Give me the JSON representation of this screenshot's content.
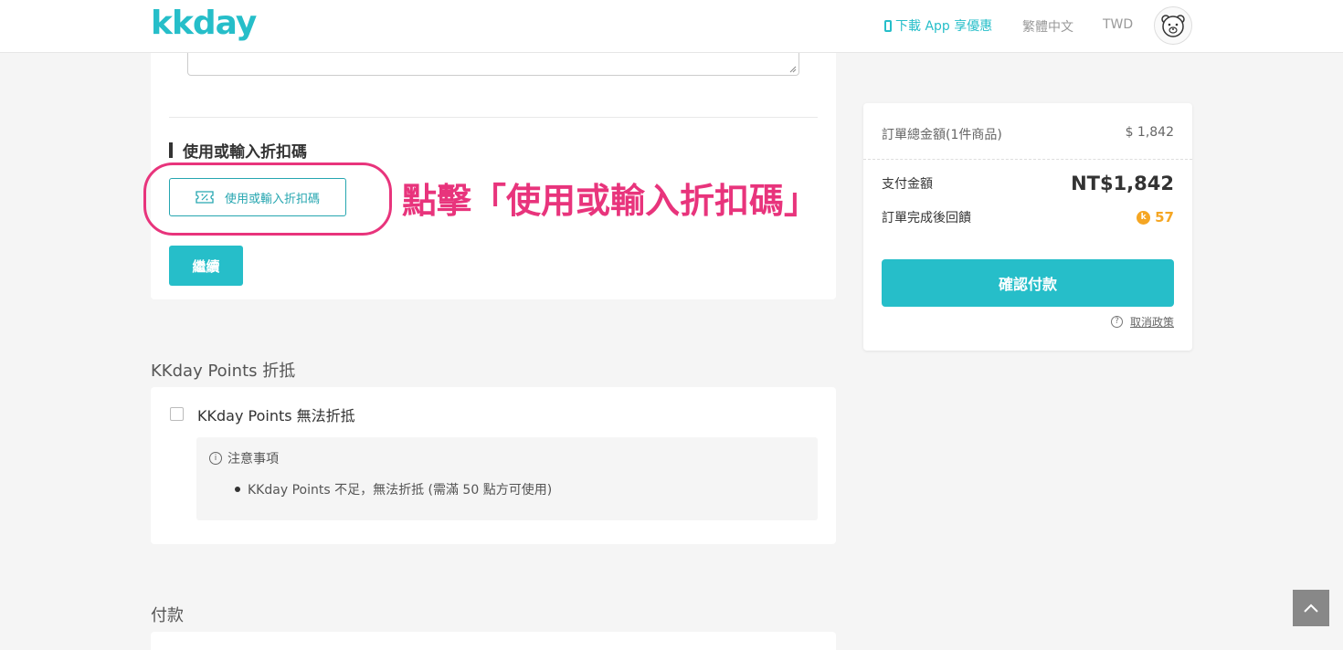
{
  "header": {
    "logo": "kkday",
    "app_promo": "下載 App 享優惠",
    "language": "繁體中文",
    "currency": "TWD"
  },
  "coupon": {
    "section_title": "使用或輸入折扣碼",
    "button_label": "使用或輸入折扣碼",
    "continue_label": "繼續",
    "annotation": "點擊「使用或輸入折扣碼」"
  },
  "points": {
    "heading": "KKday Points 折抵",
    "checkbox_label": "KKday Points 無法折抵",
    "notice_title": "注意事項",
    "notice_item": "KKday Points 不足，無法折抵 (需滿 50 點方可使用)"
  },
  "payment": {
    "heading": "付款"
  },
  "summary": {
    "total_label": "訂單總金額(1件商品)",
    "total_value": "$ 1,842",
    "pay_label": "支付金額",
    "pay_value": "NT$1,842",
    "reward_label": "訂單完成後回饋",
    "reward_value": "57",
    "confirm_label": "確認付款",
    "policy_label": "取消政策"
  },
  "colors": {
    "brand": "#26bec9",
    "annotation": "#e8347c",
    "points_gold": "#f5a623"
  }
}
